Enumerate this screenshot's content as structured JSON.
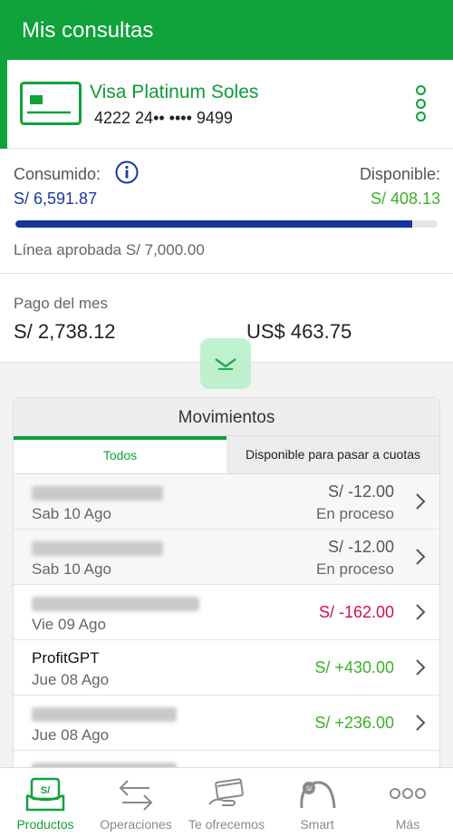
{
  "header": {
    "title": "Mis consultas"
  },
  "card": {
    "name": "Visa Platinum Soles",
    "number": "4222 24•• •••• 9499"
  },
  "balance": {
    "consumido_label": "Consumido:",
    "consumido_value": "S/ 6,591.87",
    "disponible_label": "Disponible:",
    "disponible_value": "S/ 408.13",
    "used_fraction": 0.94,
    "linea": "Línea aprobada S/ 7,000.00"
  },
  "pago": {
    "label": "Pago del mes",
    "soles": "S/ 2,738.12",
    "dolares": "US$ 463.75"
  },
  "movimientos": {
    "title": "Movimientos",
    "tabs": [
      "Todos",
      "Disponible para pasar a cuotas"
    ],
    "rows": [
      {
        "desc": "",
        "date": "Sab 10 Ago",
        "amount": "S/ -12.00",
        "status": "En proceso"
      },
      {
        "desc": "",
        "date": "Sab 10 Ago",
        "amount": "S/ -12.00",
        "status": "En proceso"
      },
      {
        "desc": "",
        "date": "Vie 09 Ago",
        "amount": "S/ -162.00",
        "status": ""
      },
      {
        "desc": "ProfitGPT",
        "date": "Jue 08 Ago",
        "amount": "S/ +430.00",
        "status": ""
      },
      {
        "desc": "",
        "date": "Jue 08 Ago",
        "amount": "S/ +236.00",
        "status": ""
      },
      {
        "desc": "",
        "date": "",
        "amount": "",
        "status": ""
      }
    ]
  },
  "nav": {
    "items": [
      "Productos",
      "Operaciones",
      "Te ofrecemos",
      "Smart",
      "Más"
    ],
    "productos_icon_text": "S/"
  },
  "colors": {
    "brand_green": "#10a23b",
    "negative": "#cc1155",
    "positive": "#3fae2a",
    "consumed_blue": "#1a3a9c"
  }
}
